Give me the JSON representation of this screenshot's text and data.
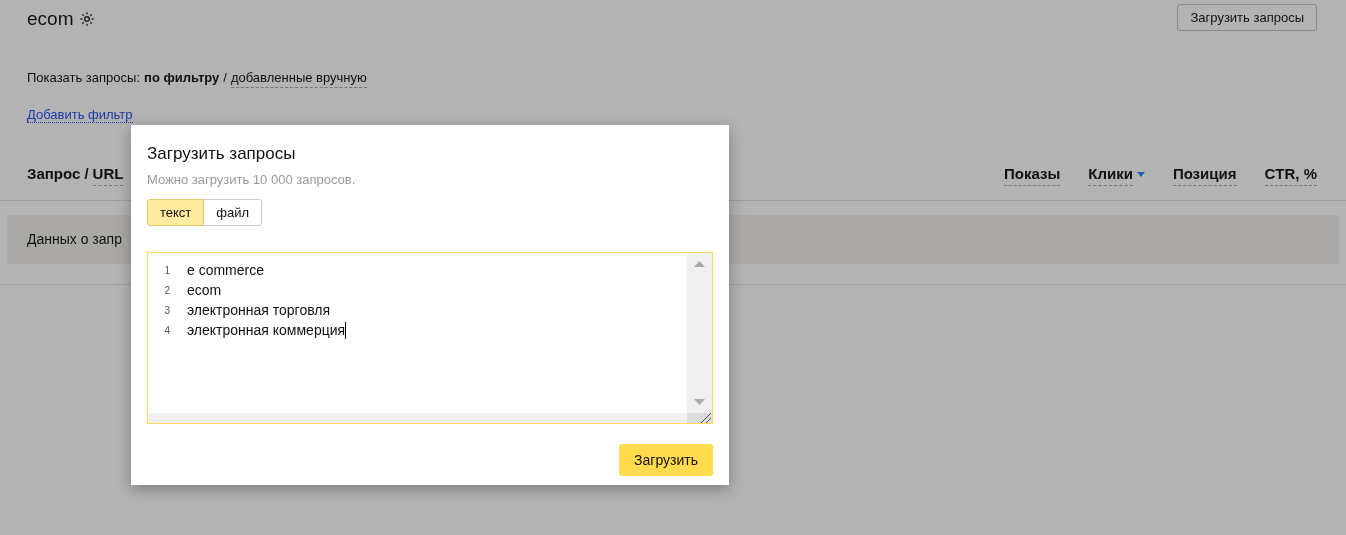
{
  "page": {
    "title": "ecom",
    "upload_button": "Загрузить запросы"
  },
  "show_queries": {
    "label": "Показать запросы:",
    "separator": "/",
    "options": [
      {
        "label": "по фильтру",
        "selected": true
      },
      {
        "label": "добавленные вручную",
        "selected": false
      }
    ]
  },
  "add_filter": "Добавить фильтр",
  "table": {
    "query_header": {
      "prefix": "Запрос /",
      "link": "URL"
    },
    "columns": [
      {
        "label": "Показы",
        "sorted": false
      },
      {
        "label": "Клики",
        "sorted": true
      },
      {
        "label": "Позиция",
        "sorted": false
      },
      {
        "label": "CTR, %",
        "sorted": false
      }
    ],
    "empty_message": "Данных о запр"
  },
  "dialog": {
    "title": "Загрузить запросы",
    "subtitle": "Можно загрузить 10 000 запросов.",
    "tabs": [
      {
        "label": "текст",
        "selected": true
      },
      {
        "label": "файл",
        "selected": false
      }
    ],
    "editor": {
      "focused": true,
      "lines": [
        {
          "number": "1",
          "text": "e commerce"
        },
        {
          "number": "2",
          "text": "ecom"
        },
        {
          "number": "3",
          "text": "электронная торговля"
        },
        {
          "number": "4",
          "text": "электронная коммерция"
        }
      ]
    },
    "submit": "Загрузить"
  }
}
